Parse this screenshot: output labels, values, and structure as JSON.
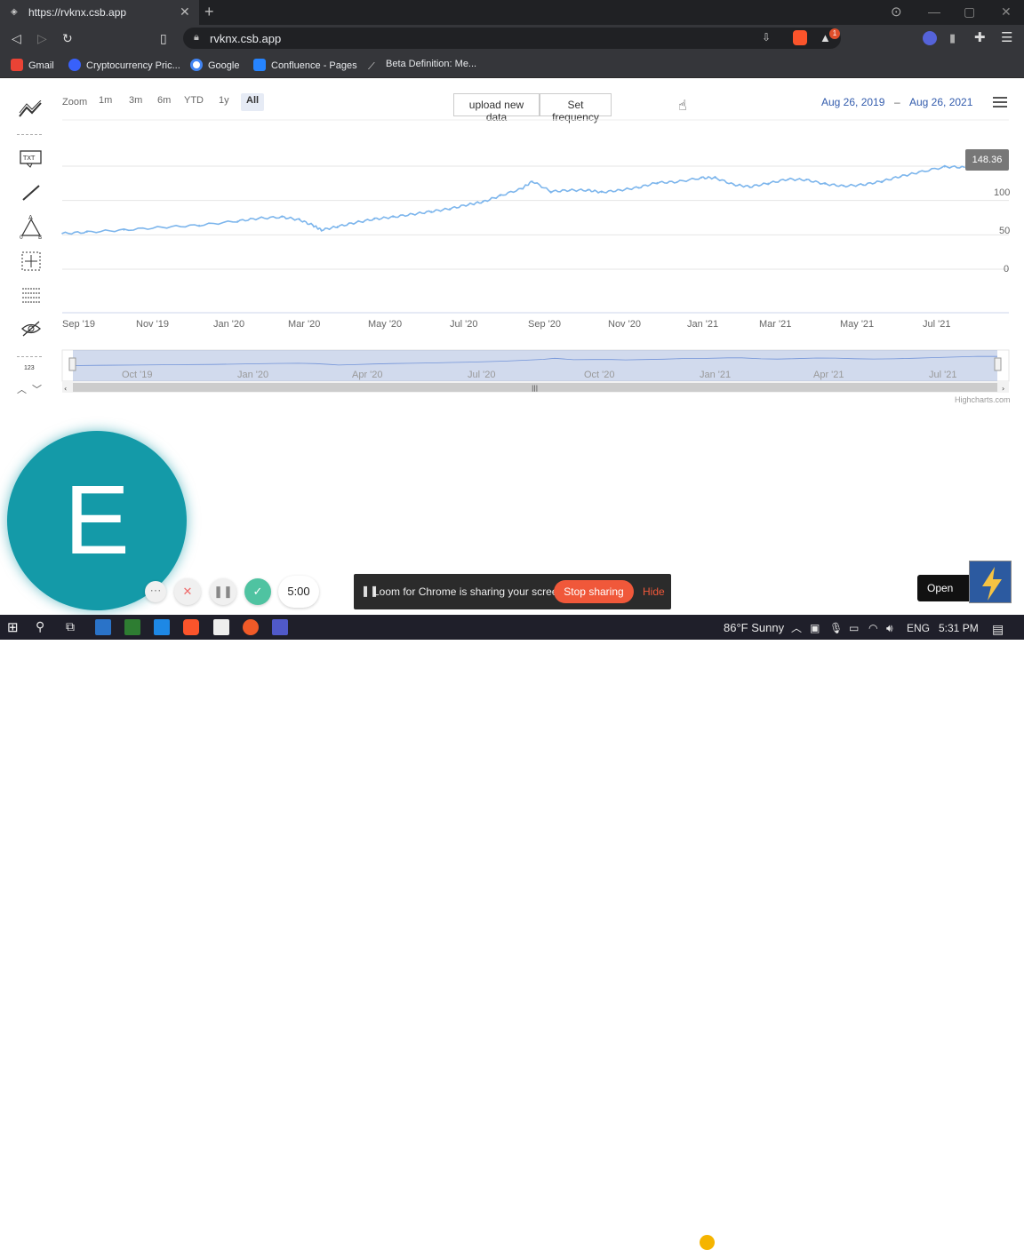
{
  "browser": {
    "tab_title": "https://rvknx.csb.app",
    "url": "rvknx.csb.app",
    "bookmarks": [
      {
        "label": "Gmail",
        "icon": "gmail-icon",
        "color": "#ea4335"
      },
      {
        "label": "Cryptocurrency Pric...",
        "icon": "coinmarketcap-icon",
        "color": "#3861fb"
      },
      {
        "label": "Google",
        "icon": "google-icon",
        "color": "#4285f4"
      },
      {
        "label": "Confluence - Pages",
        "icon": "confluence-icon",
        "color": "#2684ff"
      },
      {
        "label": "Beta Definition: Me...",
        "icon": "investopedia-icon",
        "color": "#dddddd"
      }
    ],
    "brave_badge": "1"
  },
  "toolbar": {
    "zoom_label": "Zoom",
    "ranges": [
      "1m",
      "3m",
      "6m",
      "YTD",
      "1y",
      "All"
    ],
    "active_range": "All",
    "upload_label": "upload new data",
    "frequency_label": "Set frequency",
    "date_from": "Aug 26, 2019",
    "date_sep": "–",
    "date_to": "Aug 26, 2021"
  },
  "chart_data": {
    "type": "line",
    "title": "",
    "xlabel": "",
    "ylabel": "",
    "ylim": [
      0,
      150
    ],
    "yticks": [
      "0",
      "50",
      "100"
    ],
    "xticks": [
      "Sep '19",
      "Nov '19",
      "Jan '20",
      "Mar '20",
      "May '20",
      "Jul '20",
      "Sep '20",
      "Nov '20",
      "Jan '21",
      "Mar '21",
      "May '21",
      "Jul '21"
    ],
    "navigator_ticks": [
      "Oct '19",
      "Jan '20",
      "Apr '20",
      "Jul '20",
      "Oct '20",
      "Jan '21",
      "Apr '21",
      "Jul '21"
    ],
    "last_value_label": "148.36",
    "series": [
      {
        "color": "#7cb5ec",
        "x": [
          "2019-08-26",
          "2019-09-15",
          "2019-10-15",
          "2019-11-15",
          "2019-12-15",
          "2020-01-15",
          "2020-02-01",
          "2020-02-20",
          "2020-03-05",
          "2020-03-16",
          "2020-03-23",
          "2020-04-05",
          "2020-04-20",
          "2020-05-05",
          "2020-05-20",
          "2020-06-05",
          "2020-06-20",
          "2020-07-05",
          "2020-07-20",
          "2020-08-01",
          "2020-08-15",
          "2020-09-01",
          "2020-09-10",
          "2020-09-25",
          "2020-10-10",
          "2020-10-25",
          "2020-11-05",
          "2020-11-20",
          "2020-12-05",
          "2020-12-20",
          "2021-01-05",
          "2021-01-25",
          "2021-02-05",
          "2021-02-20",
          "2021-03-05",
          "2021-03-20",
          "2021-04-05",
          "2021-04-20",
          "2021-05-05",
          "2021-05-20",
          "2021-06-05",
          "2021-06-20",
          "2021-07-05",
          "2021-07-20",
          "2021-08-10",
          "2021-08-26"
        ],
        "y": [
          52,
          54,
          57,
          61,
          64,
          70,
          74,
          76,
          72,
          64,
          57,
          62,
          68,
          73,
          76,
          80,
          84,
          88,
          94,
          98,
          107,
          117,
          128,
          113,
          115,
          115,
          112,
          115,
          119,
          126,
          127,
          133,
          133,
          123,
          120,
          125,
          131,
          130,
          124,
          121,
          123,
          128,
          135,
          141,
          149,
          148.36
        ]
      }
    ],
    "navigator": true,
    "grid": true,
    "credits": "Highcharts.com"
  },
  "loom": {
    "avatar_letter": "E",
    "timer": "5:00",
    "share_message": "Loom for Chrome is sharing your screen.",
    "stop_label": "Stop sharing",
    "hide_label": "Hide"
  },
  "sandbox": {
    "open_label": "Open Sandbox"
  },
  "taskbar": {
    "weather": "86°F  Sunny",
    "lang": "ENG",
    "time": "5:31 PM"
  }
}
